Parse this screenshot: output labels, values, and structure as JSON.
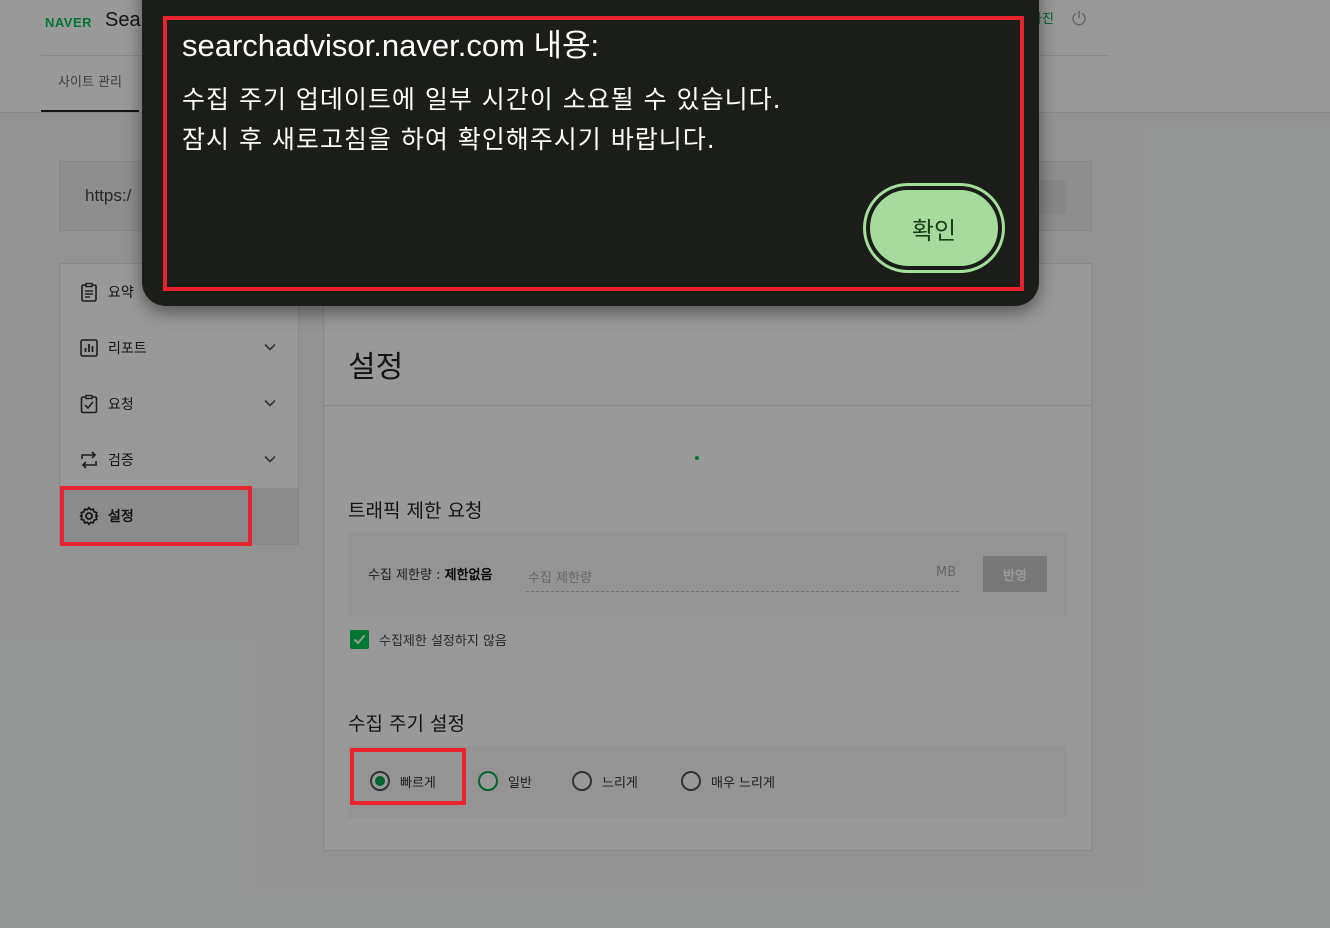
{
  "header": {
    "logo": "NAVER",
    "app_title": "Sear",
    "tab_site_manage": "사이트 관리",
    "user_label": "사진"
  },
  "url_bar": {
    "url_text": "https:/",
    "button_label": "기"
  },
  "sidebar": {
    "items": [
      {
        "label": "요약"
      },
      {
        "label": "리포트"
      },
      {
        "label": "요청"
      },
      {
        "label": "검증"
      },
      {
        "label": "설정"
      }
    ]
  },
  "main": {
    "title": "설정",
    "traffic": {
      "section_title": "트래픽 제한 요청",
      "limit_label": "수집 제한량 : ",
      "limit_value": "제한없음",
      "input_placeholder": "수집 제한량",
      "unit": "MB",
      "apply_label": "반영",
      "checkbox_label": "수집제한 설정하지 않음"
    },
    "frequency": {
      "section_title": "수집 주기 설정",
      "options": [
        "빠르게",
        "일반",
        "느리게",
        "매우 느리게"
      ],
      "selected": "빠르게"
    }
  },
  "dialog": {
    "title": "searchadvisor.naver.com 내용:",
    "message_line1": "수집 주기 업데이트에 일부 시간이 소요될 수 있습니다.",
    "message_line2": "잠시 후 새로고침을 하여 확인해주시기 바랍니다.",
    "ok_label": "확인"
  },
  "colors": {
    "accent": "#03c75a",
    "highlight": "#e8222e",
    "dialog_bg": "#1a1d18",
    "ok_button": "#a5dc9b"
  }
}
